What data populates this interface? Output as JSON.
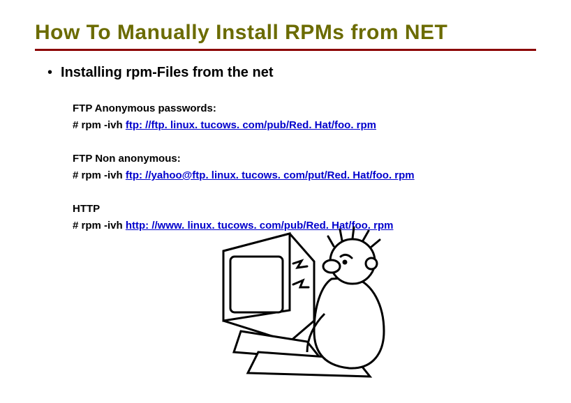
{
  "title": "How To Manually Install RPMs from NET",
  "bullet": "Installing rpm-Files from the net",
  "sections": [
    {
      "label": "FTP Anonymous passwords:",
      "cmd": "# rpm -ivh ",
      "url": "ftp: //ftp. linux. tucows. com/pub/Red. Hat/foo. rpm"
    },
    {
      "label": "FTP Non anonymous:",
      "cmd": "# rpm -ivh ",
      "url": "ftp: //yahoo@ftp. linux. tucows. com/put/Red. Hat/foo. rpm"
    },
    {
      "label": "HTTP",
      "cmd": "# rpm -ivh ",
      "url": "http: //www. linux. tucows. com/pub/Red. Hat/foo. rpm"
    }
  ]
}
